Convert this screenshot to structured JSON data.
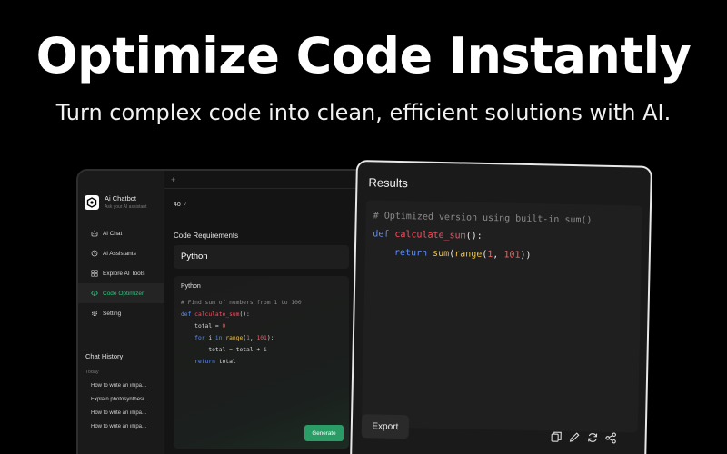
{
  "hero": {
    "title": "Optimize Code Instantly",
    "subtitle": "Turn complex code into clean, efficient solutions with AI."
  },
  "app": {
    "brand": {
      "name": "Ai Chatbot",
      "tagline": "Ask your AI assistant"
    },
    "nav": [
      {
        "label": "Ai Chat",
        "icon": "robot-icon",
        "active": false
      },
      {
        "label": "Ai Assistants",
        "icon": "history-icon",
        "active": false
      },
      {
        "label": "Explore AI Tools",
        "icon": "grid-icon",
        "active": false
      },
      {
        "label": "Code Optimizer",
        "icon": "code-icon",
        "active": true
      },
      {
        "label": "Setting",
        "icon": "gear-icon",
        "active": false
      }
    ],
    "history": {
      "title": "Chat History",
      "day": "Today",
      "items": [
        "How to write an impa...",
        "Explain photosynthesi...",
        "How to write an impa...",
        "How to write an impa..."
      ]
    },
    "tab_plus": "+",
    "model": {
      "label": "4o",
      "chevron": "˅"
    },
    "requirements": {
      "label": "Code Requirements",
      "language": "Python"
    },
    "code_card": {
      "title": "Python",
      "lines": [
        "# Find sum of numbers from 1 to 100",
        "def calculate_sum():",
        "    total = 0",
        "    for i in range(1, 101):",
        "        total = total + i",
        "    return total"
      ],
      "generate_label": "Generate"
    }
  },
  "results": {
    "title": "Results",
    "lines": [
      "# Optimized version using built-in sum()",
      "def calculate_sum():",
      "    return sum(range(1, 101))"
    ],
    "export_label": "Export",
    "actions": [
      "copy-icon",
      "edit-icon",
      "refresh-icon",
      "share-icon"
    ]
  },
  "colors": {
    "accent": "#2ec27e",
    "generate": "#2a9d66",
    "keyword": "#5a8dff",
    "function": "#ff4d5e",
    "builtin": "#f0c040"
  }
}
